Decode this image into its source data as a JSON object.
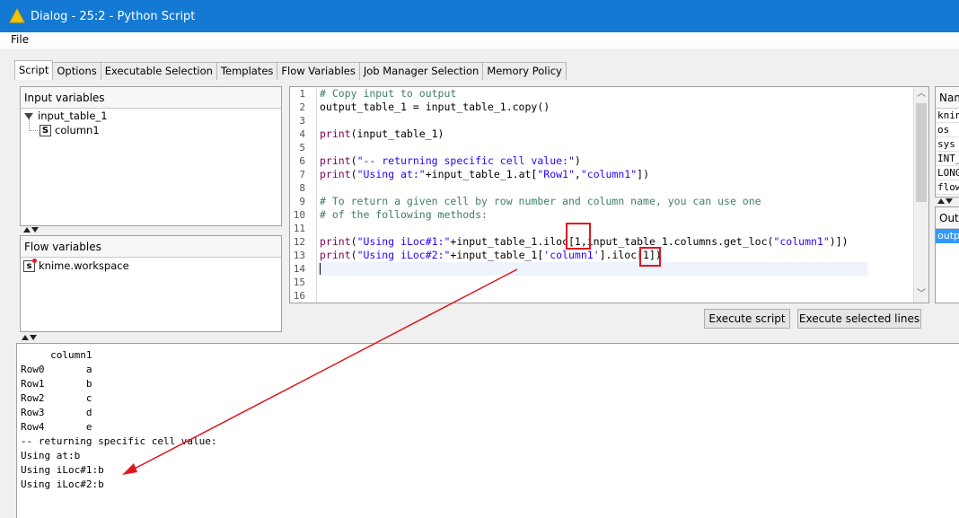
{
  "window": {
    "title": "Dialog - 25:2 - Python Script"
  },
  "menu": {
    "file": "File"
  },
  "tabs": [
    "Script",
    "Options",
    "Executable Selection",
    "Templates",
    "Flow Variables",
    "Job Manager Selection",
    "Memory Policy"
  ],
  "input_variables": {
    "header": "Input variables",
    "table": "input_table_1",
    "column_type": "S",
    "column": "column1"
  },
  "flow_variables": {
    "header": "Flow variables",
    "type_badge": "s",
    "item": "knime.workspace"
  },
  "editor": {
    "line_numbers": [
      "1",
      "2",
      "3",
      "4",
      "5",
      "6",
      "7",
      "8",
      "9",
      "10",
      "11",
      "12",
      "13",
      "14",
      "15",
      "16"
    ],
    "lines": [
      "# Copy input to output",
      "output_table_1 = input_table_1.copy()",
      "",
      "print(input_table_1)",
      "",
      "print(\"-- returning specific cell value:\")",
      "print(\"Using at:\"+input_table_1.at[\"Row1\",\"column1\"])",
      "",
      "# To return a given cell by row number and column name, you can use one",
      "# of the following methods:",
      "",
      "print(\"Using iLoc#1:\"+input_table_1.iloc[1,input_table_1.columns.get_loc(\"column1\")])",
      "print(\"Using iLoc#2:\"+input_table_1['column1'].iloc[1])",
      "",
      "",
      ""
    ]
  },
  "buttons": {
    "execute_script": "Execute script",
    "execute_selected": "Execute selected lines"
  },
  "right_panel": {
    "header": "Nam",
    "rows": [
      "knin",
      "os",
      "sys",
      "INT_",
      "LONG",
      "flow"
    ],
    "output_header": "Outp",
    "output_selected": "outpu"
  },
  "console": {
    "lines": [
      "     column1",
      "Row0       a",
      "Row1       b",
      "Row2       c",
      "Row3       d",
      "Row4       e",
      "-- returning specific cell value:",
      "Using at:b",
      "Using iLoc#1:b",
      "Using iLoc#2:b"
    ]
  },
  "colors": {
    "titlebar": "#1379d3",
    "highlight": "#e0161e",
    "selection": "#3399ff"
  }
}
